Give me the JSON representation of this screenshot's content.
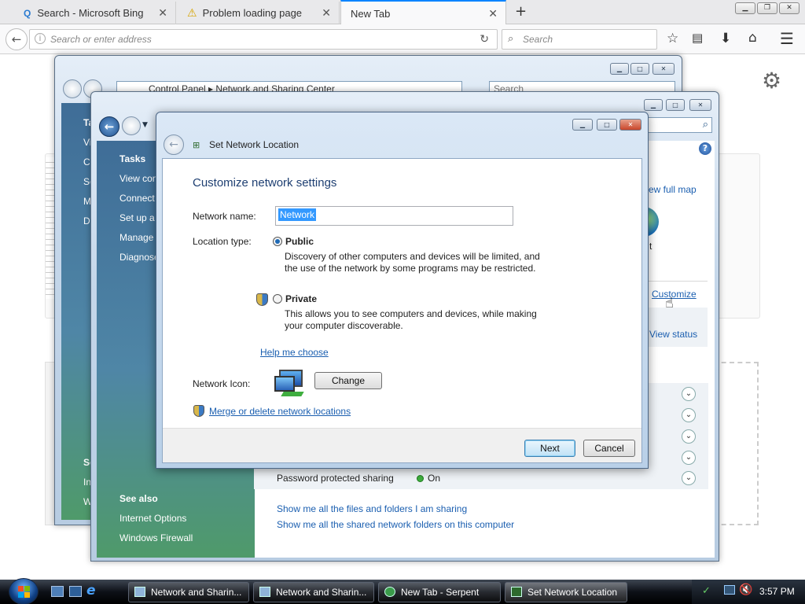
{
  "browser": {
    "tabs": [
      {
        "label": "Search - Microsoft Bing",
        "icon": "search-icon"
      },
      {
        "label": "Problem loading page",
        "icon": "warning-icon"
      },
      {
        "label": "New Tab",
        "icon": "none"
      }
    ],
    "address_placeholder": "Search or enter address",
    "search_placeholder": "Search"
  },
  "window_back": {
    "breadcrumb": [
      "Control Panel",
      "Network and Sharing Center"
    ],
    "search_placeholder": "Search",
    "tasks": [
      "Ta",
      "Vi",
      "Co",
      "Se",
      "M",
      "Di"
    ],
    "bottom": [
      "Se",
      "In",
      "W"
    ]
  },
  "window_mid": {
    "tasks_heading": "Tasks",
    "tasks": [
      "View con",
      "Connect",
      "Set up a c",
      "Manage",
      "Diagnose"
    ],
    "see_also_heading": "See also",
    "see_also": [
      "Internet Options",
      "Windows Firewall"
    ],
    "view_full_map": "ew full map",
    "internet_label": "t",
    "customize_link": "Customize",
    "view_status": "View status",
    "password_sharing_label": "Password protected sharing",
    "password_sharing_value": "On",
    "link_files": "Show me all the files and folders I am sharing",
    "link_shared": "Show me all the shared network folders on this computer"
  },
  "dialog": {
    "title": "Set Network Location",
    "heading": "Customize network settings",
    "network_name_label": "Network name:",
    "network_name_value": "Network",
    "location_type_label": "Location type:",
    "public_label": "Public",
    "public_desc_1": "Discovery of other computers and devices will be limited, and",
    "public_desc_2": "the use of the network by some programs may be restricted.",
    "private_label": "Private",
    "private_desc_1": "This allows you to see computers and devices, while making",
    "private_desc_2": "your computer discoverable.",
    "help_link": "Help me choose",
    "network_icon_label": "Network Icon:",
    "change_button": "Change",
    "merge_link": "Merge or delete network locations",
    "next_button": "Next",
    "cancel_button": "Cancel",
    "selected_location": "Public"
  },
  "taskbar": {
    "buttons": [
      "Network and Sharin...",
      "Network and Sharin...",
      "New Tab - Serpent",
      "Set Network Location"
    ],
    "clock": "3:57 PM"
  },
  "colors": {
    "accent": "#0a84ff",
    "link": "#1b5fb0",
    "status_on": "#3fae3f"
  }
}
